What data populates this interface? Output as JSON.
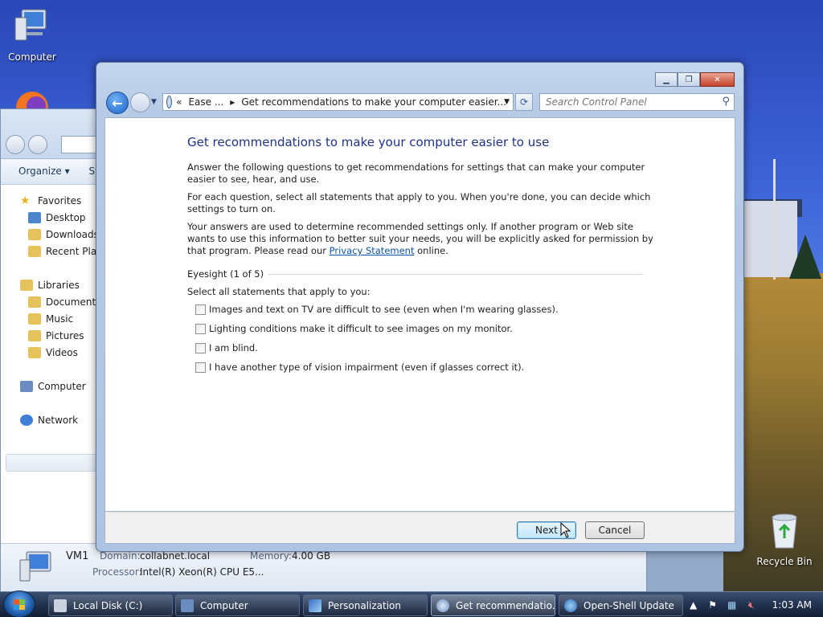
{
  "desktop": {
    "computer_label": "Computer",
    "recycle_label": "Recycle Bin"
  },
  "explorer": {
    "cmd_organize": "Organize",
    "cmd_system": "Sy",
    "nav": {
      "favorites": "Favorites",
      "desktop": "Desktop",
      "downloads": "Downloads",
      "recent": "Recent Place",
      "libraries": "Libraries",
      "documents": "Documents",
      "music": "Music",
      "pictures": "Pictures",
      "videos": "Videos",
      "computer": "Computer",
      "network": "Network"
    },
    "details": {
      "name": "VM1",
      "domain_label": "Domain:",
      "domain": "collabnet.local",
      "memory_label": "Memory:",
      "memory": "4.00 GB",
      "processor_label": "Processor:",
      "processor": "Intel(R) Xeon(R) CPU E5..."
    }
  },
  "dialog": {
    "address": {
      "chevron": "«",
      "crumb1": "Ease ...",
      "arrow": "▸",
      "crumb2": "Get recommendations to make your computer easier..."
    },
    "search_placeholder": "Search Control Panel",
    "heading": "Get recommendations to make your computer easier to use",
    "para1": "Answer the following questions to get recommendations for settings that can make your computer easier to see, hear, and use.",
    "para2": "For each question, select all statements that apply to you.  When you're done, you can decide which settings to turn on.",
    "para3_pre": "Your answers are used to determine recommended settings only. If another program or Web site wants to use this information to better suit your needs, you will be explicitly asked for permission by that program. Please read our ",
    "para3_link": "Privacy Statement",
    "para3_post": " online.",
    "section": "Eyesight (1 of 5)",
    "instruction": "Select all statements that apply to you:",
    "options": [
      "Images and text on TV are difficult to see (even when I'm wearing glasses).",
      "Lighting conditions make it difficult to see images on my monitor.",
      "I am blind.",
      "I have another type of vision impairment (even if glasses correct it)."
    ],
    "next_label": "Next",
    "cancel_label": "Cancel"
  },
  "taskbar": {
    "tasks": [
      "Local Disk (C:)",
      "Computer",
      "Personalization",
      "Get recommendatio...",
      "Open-Shell Update"
    ],
    "clock": "1:03 AM"
  }
}
